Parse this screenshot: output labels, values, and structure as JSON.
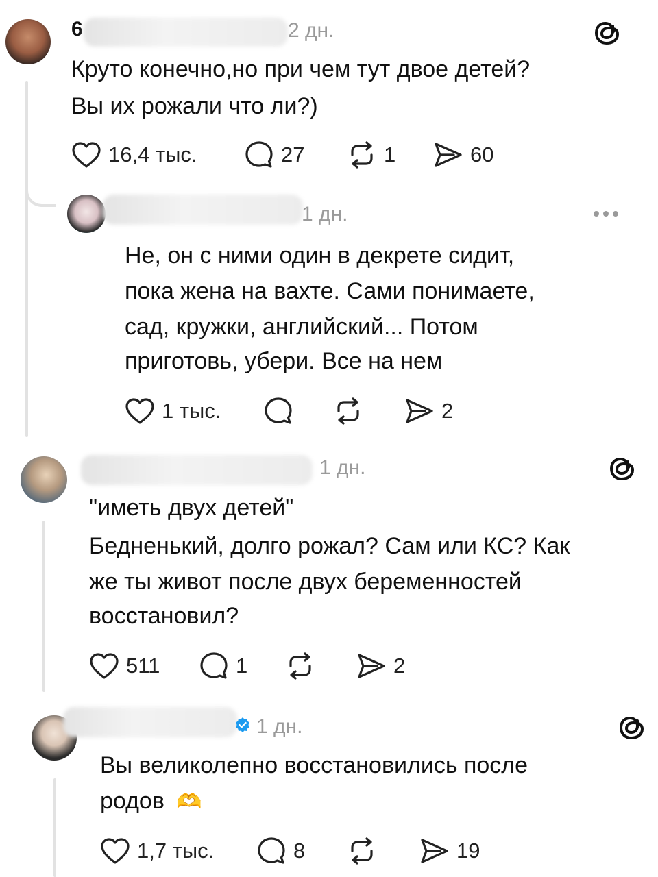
{
  "comments": [
    {
      "username_visible": "6",
      "time": "2 дн.",
      "lines": [
        "Круто конечно,но при чем тут двое детей?",
        "Вы их рожали что ли?)"
      ],
      "likes": "16,4 тыс.",
      "replies": "27",
      "reposts": "1",
      "shares": "60"
    },
    {
      "username_visible": "",
      "time": "1 дн.",
      "lines": [
        "Не, он с ними один в декрете сидит,",
        "пока жена на вахте. Сами понимаете,",
        "сад, кружки, английский... Потом",
        "приготовь, убери. Все на нем"
      ],
      "likes": "1 тыс.",
      "replies": "",
      "reposts": "",
      "shares": "2"
    },
    {
      "username_visible": "",
      "time": "1 дн.",
      "lines": [
        "\"иметь двух детей\"",
        "Бедненький, долго рожал? Сам или КС? Как",
        "же ты живот после двух беременностей",
        "восстановил?"
      ],
      "likes": "511",
      "replies": "1",
      "reposts": "",
      "shares": "2"
    },
    {
      "username_visible": "",
      "time": "1 дн.",
      "lines": [
        "Вы великолепно восстановились после",
        "родов"
      ],
      "emoji": "🫶",
      "likes": "1,7 тыс.",
      "replies": "8",
      "reposts": "",
      "shares": "19"
    }
  ],
  "colors": {
    "text": "#111111",
    "muted": "#9a9a9a",
    "thread_line": "#e2e2e2",
    "verified": "#1d9bf0"
  },
  "icons": [
    "heart-icon",
    "reply-icon",
    "repost-icon",
    "share-icon",
    "threads-logo-icon",
    "more-icon",
    "verified-icon"
  ]
}
